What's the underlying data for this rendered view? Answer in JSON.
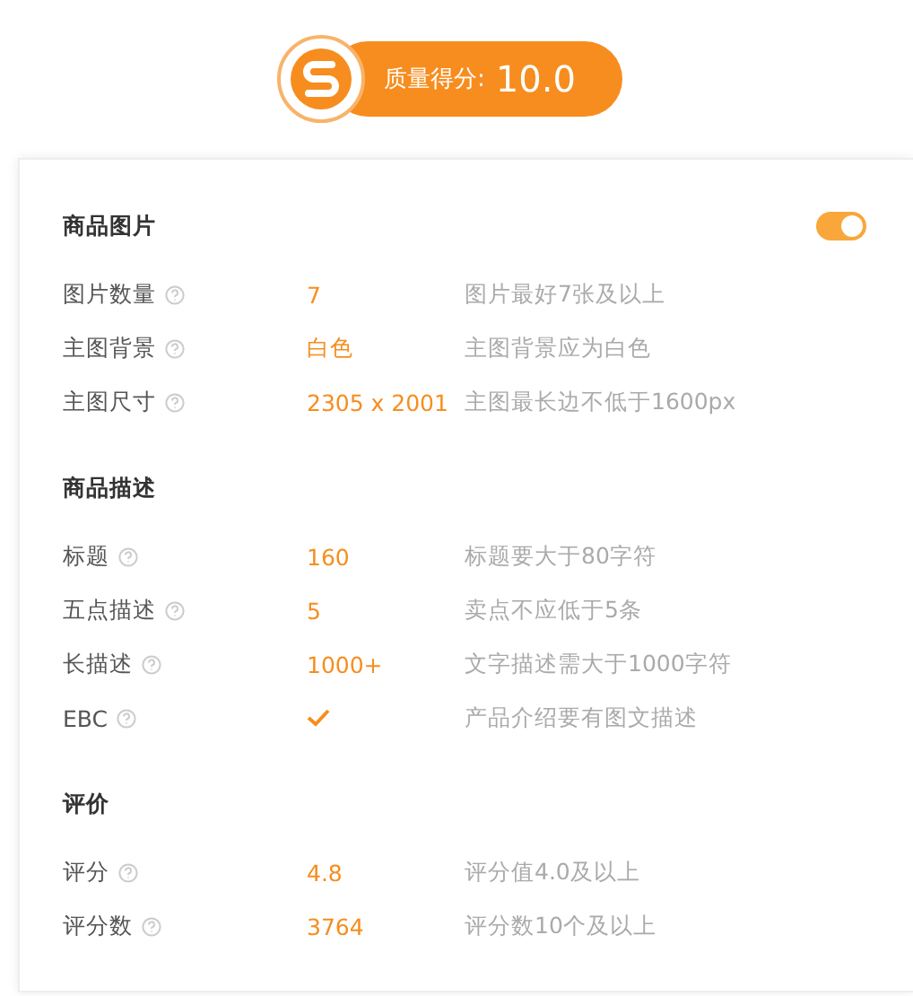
{
  "score": {
    "label": "质量得分:",
    "value": "10.0"
  },
  "sections": [
    {
      "title": "商品图片",
      "toggle": {
        "on": true
      },
      "rows": [
        {
          "kind": "text",
          "label": "图片数量",
          "value": "7",
          "hint": "图片最好7张及以上"
        },
        {
          "kind": "text",
          "label": "主图背景",
          "value": "白色",
          "hint": "主图背景应为白色"
        },
        {
          "kind": "text",
          "label": "主图尺寸",
          "value": "2305 x 2001",
          "hint": "主图最长边不低于1600px"
        }
      ]
    },
    {
      "title": "商品描述",
      "rows": [
        {
          "kind": "text",
          "label": "标题",
          "value": "160",
          "hint": "标题要大于80字符"
        },
        {
          "kind": "text",
          "label": "五点描述",
          "value": "5",
          "hint": "卖点不应低于5条"
        },
        {
          "kind": "text",
          "label": "长描述",
          "value": "1000+",
          "hint": "文字描述需大于1000字符"
        },
        {
          "kind": "check",
          "label": "EBC",
          "hint": "产品介绍要有图文描述"
        }
      ]
    },
    {
      "title": "评价",
      "rows": [
        {
          "kind": "text",
          "label": "评分",
          "value": "4.8",
          "hint": "评分值4.0及以上"
        },
        {
          "kind": "text",
          "label": "评分数",
          "value": "3764",
          "hint": "评分数10个及以上"
        }
      ]
    }
  ]
}
